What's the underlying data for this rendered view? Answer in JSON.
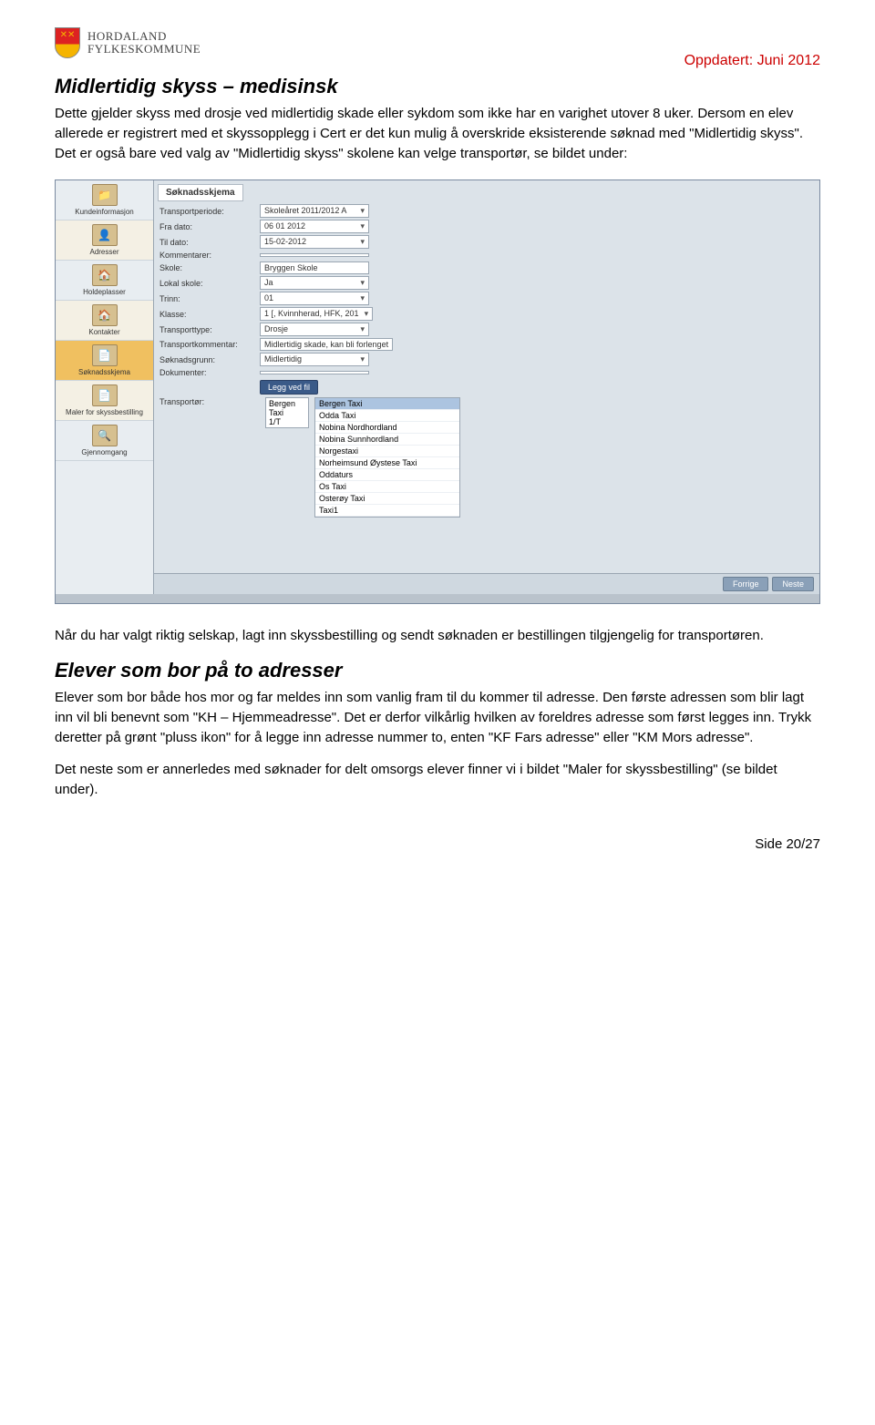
{
  "logo": {
    "line1": "HORDALAND",
    "line2": "FYLKESKOMMUNE"
  },
  "updated_note": "Oppdatert: Juni 2012",
  "section1_title": "Midlertidig skyss – medisinsk",
  "section1_body": "Dette gjelder skyss med drosje ved midlertidig skade eller sykdom som ikke har en varighet utover 8 uker. Dersom en elev allerede er registrert med et skyssopplegg i Cert er det kun mulig å overskride eksisterende søknad med \"Midlertidig skyss\". Det er også bare ved valg av \"Midlertidig skyss\" skolene kan velge transportør, se bildet under:",
  "after_image_para": "Når du har valgt riktig selskap, lagt inn skyssbestilling og sendt søknaden er bestillingen tilgjengelig for transportøren.",
  "section2_title": "Elever som bor på to adresser",
  "section2_body": "Elever som bor både hos mor og far meldes inn som vanlig fram til du kommer til adresse. Den første adressen som blir lagt inn vil bli benevnt som \"KH – Hjemmeadresse\". Det er derfor vilkårlig hvilken av foreldres adresse som først legges inn. Trykk deretter på grønt \"pluss ikon\" for å legge inn adresse nummer to, enten \"KF Fars adresse\" eller \"KM Mors adresse\".",
  "section2_extra": "Det neste som er annerledes med søknader for delt omsorgs elever finner vi i bildet \"Maler for skyssbestilling\" (se bildet under).",
  "page_number": "Side 20/27",
  "app": {
    "sidebar": [
      {
        "label": "Kundeinformasjon",
        "icon": "folder",
        "active": false,
        "alt": false
      },
      {
        "label": "Adresser",
        "icon": "user",
        "active": false,
        "alt": true
      },
      {
        "label": "Holdeplasser",
        "icon": "house",
        "active": false,
        "alt": false
      },
      {
        "label": "Kontakter",
        "icon": "house",
        "active": false,
        "alt": true
      },
      {
        "label": "Søknadsskjema",
        "icon": "sheet",
        "active": true,
        "alt": false
      },
      {
        "label": "Maler for skyssbestilling",
        "icon": "sheet",
        "active": false,
        "alt": true
      },
      {
        "label": "Gjennomgang",
        "icon": "lens",
        "active": false,
        "alt": false
      }
    ],
    "pane_title": "Søknadsskjema",
    "fields": [
      {
        "label": "Transportperiode:",
        "value": "Skoleåret 2011/2012 A",
        "dd": true
      },
      {
        "label": "Fra dato:",
        "value": "06 01 2012",
        "dd": true
      },
      {
        "label": "Til dato:",
        "value": "15-02-2012",
        "dd": true
      },
      {
        "label": "Kommentarer:",
        "value": "",
        "dd": false
      },
      {
        "label": "Skole:",
        "value": "Bryggen Skole",
        "dd": false
      },
      {
        "label": "Lokal skole:",
        "value": "Ja",
        "dd": true
      },
      {
        "label": "Trinn:",
        "value": "01",
        "dd": true
      },
      {
        "label": "Klasse:",
        "value": "1 [, Kvinnherad, HFK, 201",
        "dd": true
      },
      {
        "label": "Transporttype:",
        "value": "Drosje",
        "dd": true
      },
      {
        "label": "Transportkommentar:",
        "value": "Midlertidig skade, kan bli forlenget",
        "dd": false
      },
      {
        "label": "Søknadsgrunn:",
        "value": "Midlertidig",
        "dd": true
      },
      {
        "label": "Dokumenter:",
        "value": "",
        "dd": false
      }
    ],
    "legg_button": "Legg ved fil",
    "transportor_label": "Transportør:",
    "transportor_tr_left": {
      "line1": "Bergen Taxi",
      "line2": "1/T"
    },
    "transportor_options": [
      {
        "name": "Bergen Taxi",
        "selected": true
      },
      {
        "name": "Odda Taxi",
        "selected": false
      },
      {
        "name": "Nobina Nordhordland",
        "selected": false
      },
      {
        "name": "Nobina Sunnhordland",
        "selected": false
      },
      {
        "name": "Norgestaxi",
        "selected": false
      },
      {
        "name": "Norheimsund Øystese Taxi",
        "selected": false
      },
      {
        "name": "Oddaturs",
        "selected": false
      },
      {
        "name": "Os Taxi",
        "selected": false
      },
      {
        "name": "Osterøy Taxi",
        "selected": false
      },
      {
        "name": "Taxi1",
        "selected": false
      }
    ],
    "footer_buttons": {
      "prev": "Forrige",
      "next": "Neste"
    }
  }
}
